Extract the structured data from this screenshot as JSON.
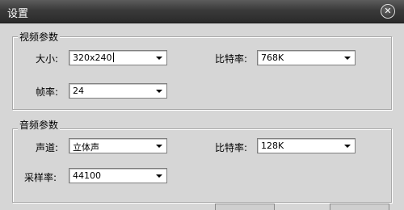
{
  "window": {
    "title": "设置"
  },
  "video": {
    "group_title": "视频参数",
    "size_label": "大小:",
    "size_value": "320x240",
    "bitrate_label": "比特率:",
    "bitrate_value": "768K",
    "framerate_label": "帧率:",
    "framerate_value": "24"
  },
  "audio": {
    "group_title": "音频参数",
    "channel_label": "声道:",
    "channel_value": "立体声",
    "bitrate_label": "比特率:",
    "bitrate_value": "128K",
    "samplerate_label": "采样率:",
    "samplerate_value": "44100"
  },
  "icons": {
    "close": "close-icon",
    "dropdown": "chevron-down-icon"
  }
}
